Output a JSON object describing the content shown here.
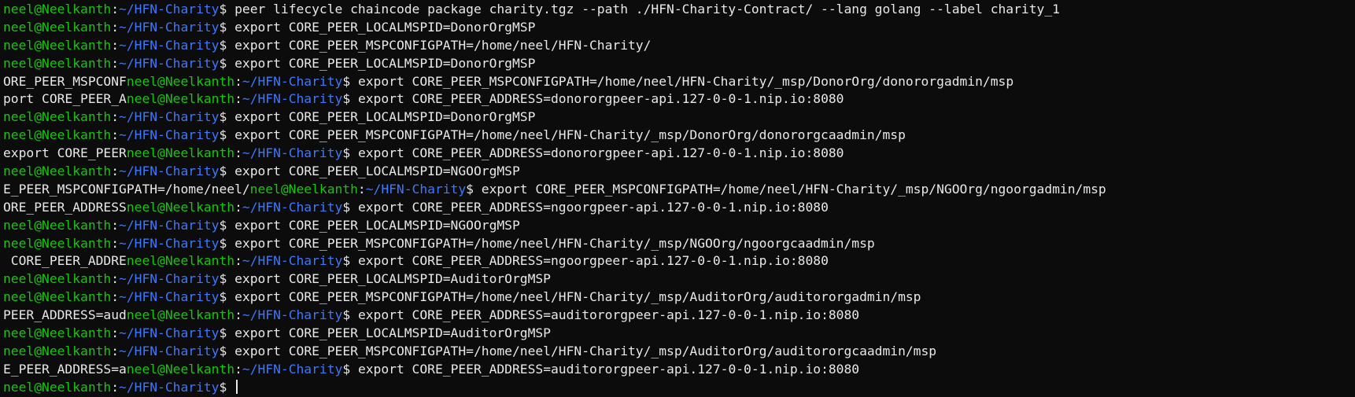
{
  "terminal": {
    "prompt": {
      "user_host": "neel@Neelkanth",
      "colon": ":",
      "path": "~/HFN-Charity",
      "dollar": "$ "
    },
    "lines": [
      {
        "residue": "",
        "cmd": "peer lifecycle chaincode package charity.tgz --path ./HFN-Charity-Contract/ --lang golang --label charity_1"
      },
      {
        "residue": "",
        "cmd": "export CORE_PEER_LOCALMSPID=DonorOrgMSP"
      },
      {
        "residue": "",
        "cmd": "export CORE_PEER_MSPCONFIGPATH=/home/neel/HFN-Charity/"
      },
      {
        "residue": "",
        "cmd": "export CORE_PEER_LOCALMSPID=DonorOrgMSP"
      },
      {
        "residue": "ORE_PEER_MSPCONF",
        "cmd": "export CORE_PEER_MSPCONFIGPATH=/home/neel/HFN-Charity/_msp/DonorOrg/donororgadmin/msp"
      },
      {
        "residue": "port CORE_PEER_A",
        "cmd": "export CORE_PEER_ADDRESS=donororgpeer-api.127-0-0-1.nip.io:8080"
      },
      {
        "residue": "",
        "cmd": "export CORE_PEER_LOCALMSPID=DonorOrgMSP"
      },
      {
        "residue": "",
        "cmd": "export CORE_PEER_MSPCONFIGPATH=/home/neel/HFN-Charity/_msp/DonorOrg/donororgcaadmin/msp"
      },
      {
        "residue": "export CORE_PEER",
        "cmd": "export CORE_PEER_ADDRESS=donororgpeer-api.127-0-0-1.nip.io:8080"
      },
      {
        "residue": "",
        "cmd": "export CORE_PEER_LOCALMSPID=NGOOrgMSP"
      },
      {
        "residue": "E_PEER_MSPCONFIGPATH=/home/neel/",
        "cmd": "export CORE_PEER_MSPCONFIGPATH=/home/neel/HFN-Charity/_msp/NGOOrg/ngoorgadmin/msp"
      },
      {
        "residue": "ORE_PEER_ADDRESS",
        "cmd": "export CORE_PEER_ADDRESS=ngoorgpeer-api.127-0-0-1.nip.io:8080"
      },
      {
        "residue": "",
        "cmd": "export CORE_PEER_LOCALMSPID=NGOOrgMSP"
      },
      {
        "residue": "",
        "cmd": "export CORE_PEER_MSPCONFIGPATH=/home/neel/HFN-Charity/_msp/NGOOrg/ngoorgcaadmin/msp"
      },
      {
        "residue": " CORE_PEER_ADDRE",
        "cmd": "export CORE_PEER_ADDRESS=ngoorgpeer-api.127-0-0-1.nip.io:8080"
      },
      {
        "residue": "",
        "cmd": "export CORE_PEER_LOCALMSPID=AuditorOrgMSP"
      },
      {
        "residue": "",
        "cmd": "export CORE_PEER_MSPCONFIGPATH=/home/neel/HFN-Charity/_msp/AuditorOrg/auditororgadmin/msp"
      },
      {
        "residue": "PEER_ADDRESS=aud",
        "cmd": "export CORE_PEER_ADDRESS=auditororgpeer-api.127-0-0-1.nip.io:8080"
      },
      {
        "residue": "",
        "cmd": "export CORE_PEER_LOCALMSPID=AuditorOrgMSP"
      },
      {
        "residue": "",
        "cmd": "export CORE_PEER_MSPCONFIGPATH=/home/neel/HFN-Charity/_msp/AuditorOrg/auditororgcaadmin/msp"
      },
      {
        "residue": "E_PEER_ADDRESS=a",
        "cmd": "export CORE_PEER_ADDRESS=auditororgpeer-api.127-0-0-1.nip.io:8080"
      },
      {
        "residue": "",
        "cmd": ""
      }
    ]
  },
  "colors": {
    "background": "#0c0c0c",
    "prompt_user": "#16c60c",
    "prompt_path": "#3b78ff",
    "text": "#e8e8e8"
  }
}
